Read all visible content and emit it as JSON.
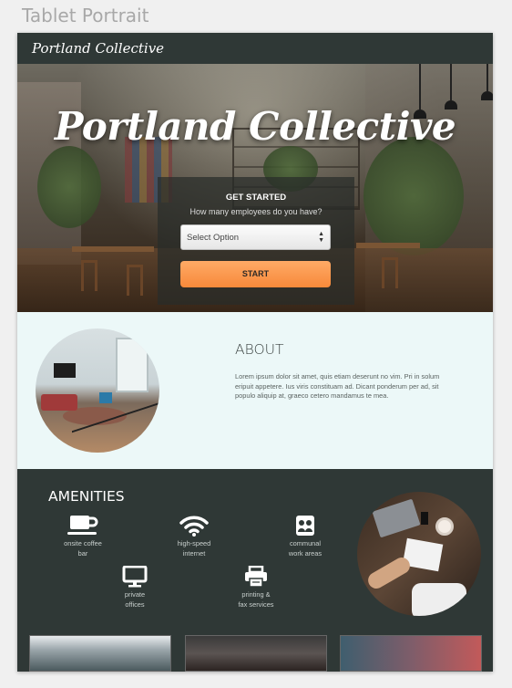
{
  "artboard_label": "Tablet Portrait",
  "navbar": {
    "logo": "Portland Collective"
  },
  "hero": {
    "title": "Portland Collective",
    "form": {
      "heading": "GET STARTED",
      "question": "How many employees do you have?",
      "select_value": "Select Option",
      "start_label": "START"
    }
  },
  "about": {
    "title": "ABOUT",
    "body": "Lorem ipsum dolor sit amet, quis etiam deserunt no vim. Pri in solum eripuit appetere. Ius viris constituam ad. Dicant ponderum per ad, sit populo aliquip at, graeco cetero mandamus te mea."
  },
  "amenities": {
    "title": "AMENITIES",
    "items": [
      {
        "icon": "coffee-cup-icon",
        "line1": "onsite coffee",
        "line2": "bar"
      },
      {
        "icon": "wifi-icon",
        "line1": "high-speed",
        "line2": "internet"
      },
      {
        "icon": "communal-icon",
        "line1": "communal",
        "line2": "work areas"
      },
      {
        "icon": "monitor-icon",
        "line1": "private",
        "line2": "offices"
      },
      {
        "icon": "printer-icon",
        "line1": "printing &",
        "line2": "fax services"
      }
    ]
  },
  "colors": {
    "dark": "#2f3836",
    "accent": "#f7893a",
    "about_bg": "#ecf8f8"
  }
}
